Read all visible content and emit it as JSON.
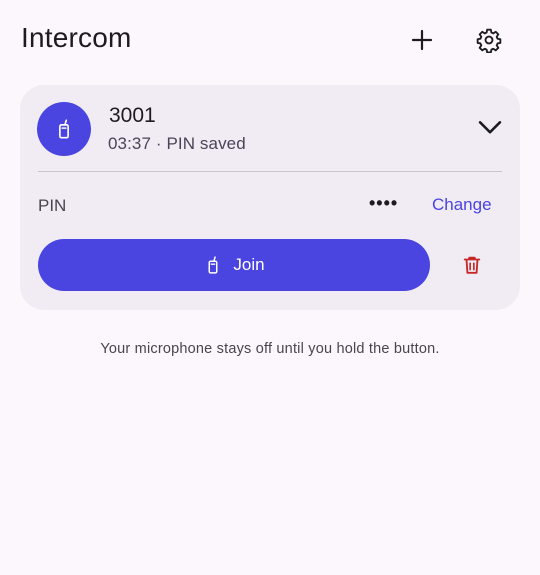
{
  "header": {
    "title": "Intercom",
    "add_icon": "plus-icon",
    "settings_icon": "gear-icon"
  },
  "room": {
    "name": "3001",
    "subtitle": "03:37 · PIN saved",
    "avatar_icon": "walkie-talkie-icon",
    "expanded": true,
    "pin_label": "PIN",
    "pin_masked": "••••",
    "change_label": "Change",
    "join_label": "Join",
    "join_icon": "walkie-talkie-icon",
    "delete_icon": "trash-icon"
  },
  "footnote": "Your microphone stays off until you hold the button.",
  "colors": {
    "background": "#fcf7fc",
    "card": "#f1ecf4",
    "accent": "#4a44e0",
    "danger": "#c62828"
  }
}
